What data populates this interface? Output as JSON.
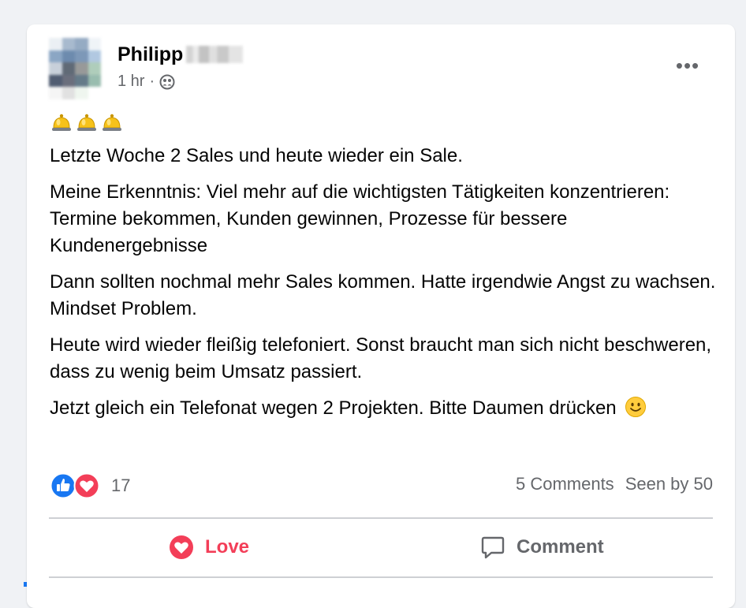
{
  "post": {
    "author_first_name": "Philipp",
    "timestamp": "1 hr",
    "separator": "·",
    "audience_icon": "friends-icon",
    "more_icon": "more-options-icon",
    "more_label": "•••",
    "emoji_line_icons": [
      "bell-icon",
      "bell-icon",
      "bell-icon"
    ],
    "paragraphs": [
      "Letzte Woche 2 Sales und heute wieder ein Sale.",
      "Meine Erkenntnis: Viel mehr auf die wichtigsten Tätigkeiten konzentrieren: Termine bekommen, Kunden gewinnen, Prozesse für bessere Kundenergebnisse",
      "Dann sollten nochmal mehr Sales kommen. Hatte irgendwie Angst zu wachsen. Mindset Problem.",
      "Heute wird wieder fleißig telefoniert. Sonst braucht man sich nicht beschweren, dass zu wenig beim Umsatz passiert.",
      "Jetzt gleich ein Telefonat wegen 2 Projekten. Bitte Daumen drücken"
    ],
    "last_paragraph_emoji": "smiley-icon"
  },
  "stats": {
    "reaction_icons": [
      "like-icon",
      "love-icon"
    ],
    "reaction_count": "17",
    "comments": "5 Comments",
    "seen_by": "Seen by 50"
  },
  "actions": {
    "love_label": "Love",
    "comment_label": "Comment"
  },
  "colors": {
    "love": "#f33e58",
    "like": "#1877f2",
    "secondary_text": "#65676b",
    "divider": "#ced0d4"
  }
}
